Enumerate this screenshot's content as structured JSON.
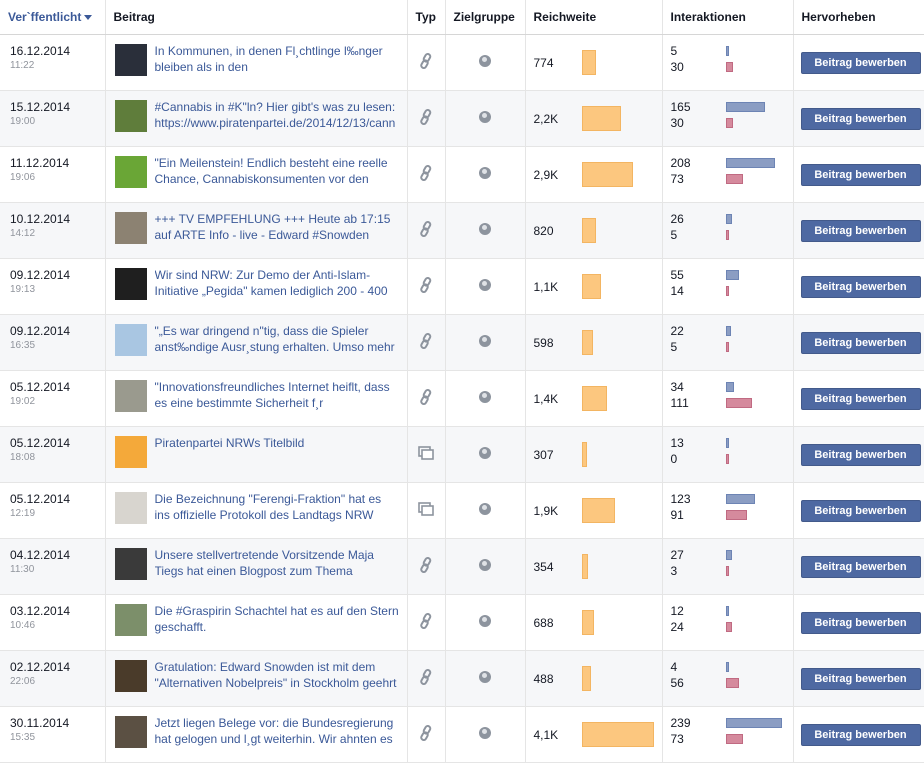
{
  "columns": {
    "published": "Ver`ffentlicht",
    "post": "Beitrag",
    "type": "Typ",
    "audience": "Zielgruppe",
    "reach": "Reichweite",
    "interactions": "Interaktionen",
    "promote": "Hervorheben"
  },
  "promote_label": "Beitrag bewerben",
  "colors": {
    "reach_bar": "#fcc77f",
    "interactions_primary": "#8b9dc3",
    "interactions_secondary": "#d58a9d",
    "button": "#4e69a2",
    "link": "#3b5998"
  },
  "rows": [
    {
      "date": "16.12.2014",
      "time": "11:22",
      "text": "In Kommunen, in denen Fl¸chtlinge l‰nger bleiben als in den",
      "type_icon": "link-icon",
      "reach": "774",
      "reach_value": 774,
      "int_a": "5",
      "int_b": "30",
      "int_a_value": 5,
      "int_b_value": 30,
      "thumb": "#2a2f3a"
    },
    {
      "date": "15.12.2014",
      "time": "19:00",
      "text": "#Cannabis in #K\"ln? Hier gibt's was zu lesen: https://www.piratenpartei.de/2014/12/13/cann",
      "type_icon": "link-icon",
      "reach": "2,2K",
      "reach_value": 2200,
      "int_a": "165",
      "int_b": "30",
      "int_a_value": 165,
      "int_b_value": 30,
      "thumb": "#5f7d3b"
    },
    {
      "date": "11.12.2014",
      "time": "19:06",
      "text": "\"Ein Meilenstein! Endlich besteht eine reelle Chance, Cannabiskonsumenten vor den",
      "type_icon": "link-icon",
      "reach": "2,9K",
      "reach_value": 2900,
      "int_a": "208",
      "int_b": "73",
      "int_a_value": 208,
      "int_b_value": 73,
      "thumb": "#6aa636"
    },
    {
      "date": "10.12.2014",
      "time": "14:12",
      "text": "+++ TV EMPFEHLUNG +++ Heute ab 17:15 auf ARTE Info - live - Edward #Snowden",
      "type_icon": "link-icon",
      "reach": "820",
      "reach_value": 820,
      "int_a": "26",
      "int_b": "5",
      "int_a_value": 26,
      "int_b_value": 5,
      "thumb": "#8c8272"
    },
    {
      "date": "09.12.2014",
      "time": "19:13",
      "text": "Wir sind NRW: Zur Demo der Anti-Islam-Initiative „Pegida\" kamen lediglich 200 - 400",
      "type_icon": "link-icon",
      "reach": "1,1K",
      "reach_value": 1100,
      "int_a": "55",
      "int_b": "14",
      "int_a_value": 55,
      "int_b_value": 14,
      "thumb": "#1f1f1f"
    },
    {
      "date": "09.12.2014",
      "time": "16:35",
      "text": "\"„Es war dringend n\"tig, dass die Spieler anst‰ndige Ausr¸stung erhalten. Umso mehr",
      "type_icon": "link-icon",
      "reach": "598",
      "reach_value": 598,
      "int_a": "22",
      "int_b": "5",
      "int_a_value": 22,
      "int_b_value": 5,
      "thumb": "#a9c6e2"
    },
    {
      "date": "05.12.2014",
      "time": "19:02",
      "text": "\"Innovationsfreundliches Internet heiflt, dass es eine bestimmte Sicherheit f¸r",
      "type_icon": "link-icon",
      "reach": "1,4K",
      "reach_value": 1400,
      "int_a": "34",
      "int_b": "111",
      "int_a_value": 34,
      "int_b_value": 111,
      "thumb": "#9a9a8e"
    },
    {
      "date": "05.12.2014",
      "time": "18:08",
      "text": "Piratenpartei NRWs Titelbild",
      "type_icon": "photo-icon",
      "reach": "307",
      "reach_value": 307,
      "int_a": "13",
      "int_b": "0",
      "int_a_value": 13,
      "int_b_value": 0,
      "thumb": "#f4a93a"
    },
    {
      "date": "05.12.2014",
      "time": "12:19",
      "text": "Die Bezeichnung \"Ferengi-Fraktion\" hat es ins offizielle Protokoll des Landtags NRW",
      "type_icon": "photo-icon",
      "reach": "1,9K",
      "reach_value": 1900,
      "int_a": "123",
      "int_b": "91",
      "int_a_value": 123,
      "int_b_value": 91,
      "thumb": "#d8d5cf"
    },
    {
      "date": "04.12.2014",
      "time": "11:30",
      "text": "Unsere stellvertretende Vorsitzende Maja Tiegs hat einen Blogpost zum Thema",
      "type_icon": "link-icon",
      "reach": "354",
      "reach_value": 354,
      "int_a": "27",
      "int_b": "3",
      "int_a_value": 27,
      "int_b_value": 3,
      "thumb": "#3a3a3a"
    },
    {
      "date": "03.12.2014",
      "time": "10:46",
      "text": "Die #Graspirin Schachtel hat es auf den Stern geschafft.",
      "type_icon": "link-icon",
      "reach": "688",
      "reach_value": 688,
      "int_a": "12",
      "int_b": "24",
      "int_a_value": 12,
      "int_b_value": 24,
      "thumb": "#7c8f6a"
    },
    {
      "date": "02.12.2014",
      "time": "22:06",
      "text": "Gratulation: Edward Snowden ist mit dem \"Alternativen Nobelpreis\" in Stockholm geehrt",
      "type_icon": "link-icon",
      "reach": "488",
      "reach_value": 488,
      "int_a": "4",
      "int_b": "56",
      "int_a_value": 4,
      "int_b_value": 56,
      "thumb": "#4a3b2a"
    },
    {
      "date": "30.11.2014",
      "time": "15:35",
      "text": "Jetzt liegen Belege vor: die Bundesregierung hat gelogen und l¸gt weiterhin. Wir ahnten es",
      "type_icon": "link-icon",
      "reach": "4,1K",
      "reach_value": 4100,
      "int_a": "239",
      "int_b": "73",
      "int_a_value": 239,
      "int_b_value": 73,
      "thumb": "#5b5043"
    }
  ]
}
